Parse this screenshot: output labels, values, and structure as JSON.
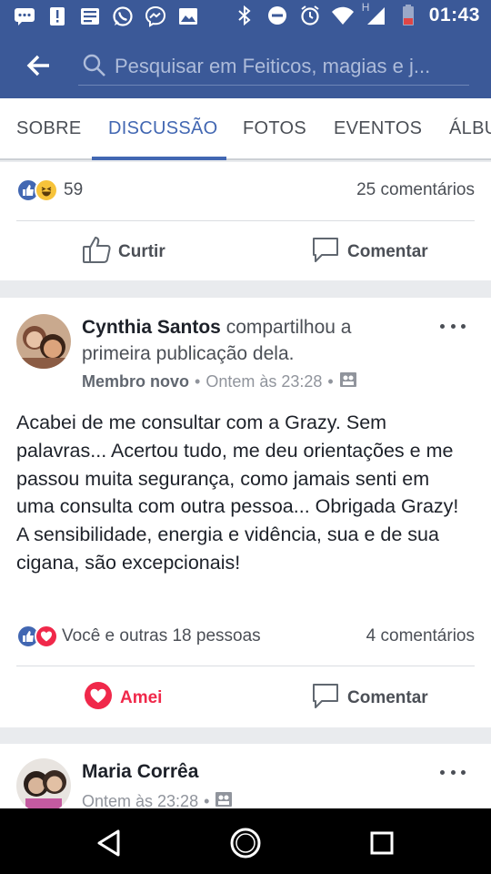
{
  "status_bar": {
    "time": "01:43",
    "network_label": "H",
    "icons_left": [
      "chat-icon",
      "alert-icon",
      "news-icon",
      "whatsapp-icon",
      "messenger-icon",
      "image-icon"
    ],
    "icons_right": [
      "bluetooth-icon",
      "dnd-icon",
      "alarm-icon",
      "wifi-icon",
      "signal-icon",
      "battery-icon"
    ]
  },
  "app_bar": {
    "search_placeholder": "Pesquisar em Feiticos, magias e j..."
  },
  "tabs": [
    "SOBRE",
    "DISCUSSÃO",
    "FOTOS",
    "EVENTOS",
    "ÁLBU"
  ],
  "active_tab": "DISCUSSÃO",
  "post1": {
    "reaction_count": "59",
    "comments": "25 comentários",
    "like_label": "Curtir",
    "comment_label": "Comentar"
  },
  "post2": {
    "author": "Cynthia Santos",
    "action_text": "compartilhou a primeira publicação dela.",
    "badge": "Membro novo",
    "time": "Ontem às 23:28",
    "body": "Acabei de me consultar com a Grazy. Sem palavras... Acertou tudo, me deu orientações e me passou muita segurança, como jamais senti em uma consulta com outra pessoa... Obrigada Grazy! A sensibilidade, energia e vidência, sua e de sua cigana, são excepcionais!",
    "reactions_text": "Você e outras 18 pessoas",
    "comments": "4 comentários",
    "love_label": "Amei",
    "comment_label": "Comentar"
  },
  "post3": {
    "author": "Maria Corrêa",
    "time": "Ontem às 23:28"
  },
  "colors": {
    "brand": "#3b5998",
    "active_tab": "#4267b2",
    "love": "#f0284a",
    "like": "#4267b2"
  }
}
